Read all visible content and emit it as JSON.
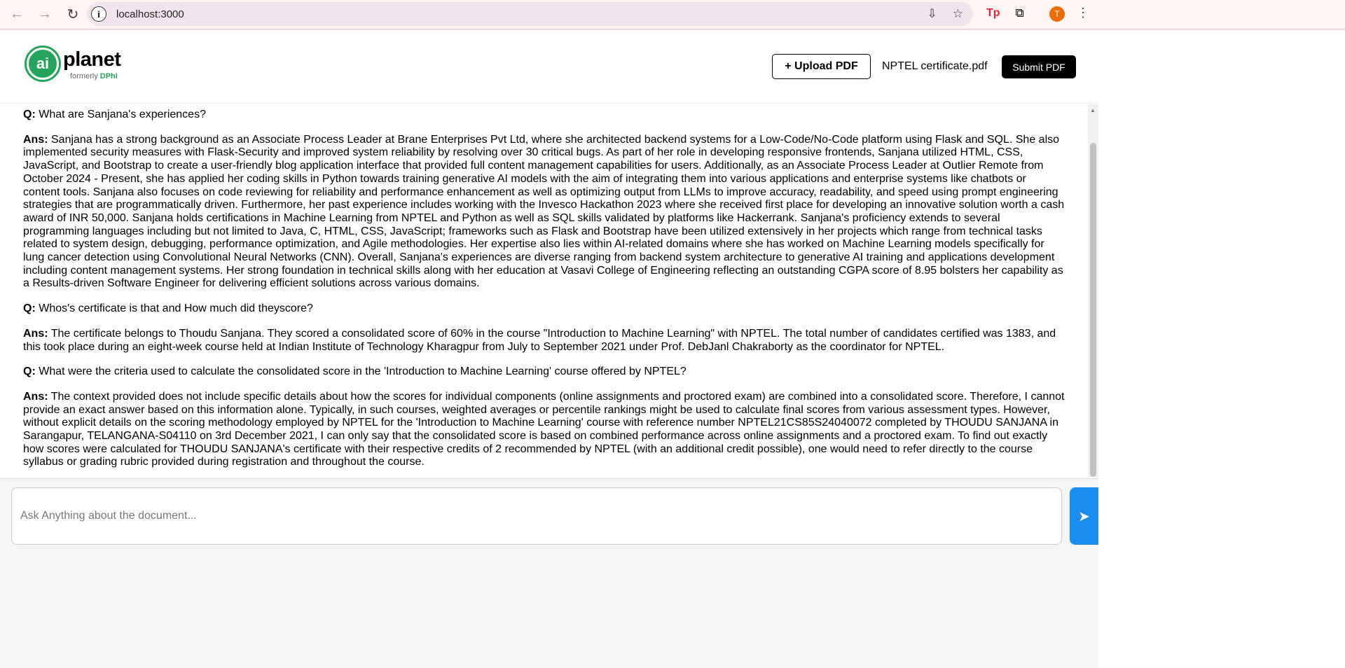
{
  "browser": {
    "url": "localhost:3000",
    "avatar_letter": "T",
    "ext_label": "Tp"
  },
  "header": {
    "logo_word": "planet",
    "logo_mark": "ai",
    "logo_sub": "formerly ",
    "logo_sub_brand": "DPhi",
    "upload_label": "+ Upload PDF",
    "file_name": "NPTEL certificate.pdf",
    "submit_label": "Submit PDF"
  },
  "messages": [
    {
      "q_label": "Q:",
      "q": " What are Sanjana's experiences?",
      "a_label": "Ans:",
      "a": " Sanjana has a strong background as an Associate Process Leader at Brane Enterprises Pvt Ltd, where she architected backend systems for a Low-Code/No-Code platform using Flask and SQL. She also implemented security measures with Flask-Security and improved system reliability by resolving over 30 critical bugs. As part of her role in developing responsive frontends, Sanjana utilized HTML, CSS, JavaScript, and Bootstrap to create a user-friendly blog application interface that provided full content management capabilities for users. Additionally, as an Associate Process Leader at Outlier Remote from October 2024 - Present, she has applied her coding skills in Python towards training generative AI models with the aim of integrating them into various applications and enterprise systems like chatbots or content tools. Sanjana also focuses on code reviewing for reliability and performance enhancement as well as optimizing output from LLMs to improve accuracy, readability, and speed using prompt engineering strategies that are programmatically driven. Furthermore, her past experience includes working with the Invesco Hackathon 2023 where she received first place for developing an innovative solution worth a cash award of INR 50,000. Sanjana holds certifications in Machine Learning from NPTEL and Python as well as SQL skills validated by platforms like Hackerrank. Sanjana's proficiency extends to several programming languages including but not limited to Java, C, HTML, CSS, JavaScript; frameworks such as Flask and Bootstrap have been utilized extensively in her projects which range from technical tasks related to system design, debugging, performance optimization, and Agile methodologies. Her expertise also lies within AI-related domains where she has worked on Machine Learning models specifically for lung cancer detection using Convolutional Neural Networks (CNN). Overall, Sanjana's experiences are diverse ranging from backend system architecture to generative AI training and applications development including content management systems. Her strong foundation in technical skills along with her education at Vasavi College of Engineering reflecting an outstanding CGPA score of 8.95 bolsters her capability as a Results-driven Software Engineer for delivering efficient solutions across various domains."
    },
    {
      "q_label": "Q:",
      "q": " Whos's certificate is that and How much did theyscore?",
      "a_label": "Ans:",
      "a": " The certificate belongs to Thoudu Sanjana. They scored a consolidated score of 60% in the course \"Introduction to Machine Learning\" with NPTEL. The total number of candidates certified was 1383, and this took place during an eight-week course held at Indian Institute of Technology Kharagpur from July to September 2021 under Prof. DebJanl Chakraborty as the coordinator for NPTEL."
    },
    {
      "q_label": "Q:",
      "q": " What were the criteria used to calculate the consolidated score in the 'Introduction to Machine Learning' course offered by NPTEL?",
      "a_label": "Ans:",
      "a": " The context provided does not include specific details about how the scores for individual components (online assignments and proctored exam) are combined into a consolidated score. Therefore, I cannot provide an exact answer based on this information alone. Typically, in such courses, weighted averages or percentile rankings might be used to calculate final scores from various assessment types. However, without explicit details on the scoring methodology employed by NPTEL for the 'Introduction to Machine Learning' course with reference number NPTEL21CS85S24040072 completed by THOUDU SANJANA in Sarangapur, TELANGANA-S04110 on 3rd December 2021, I can only say that the consolidated score is based on combined performance across online assignments and a proctored exam. To find out exactly how scores were calculated for THOUDU SANJANA's certificate with their respective credits of 2 recommended by NPTEL (with an additional credit possible), one would need to refer directly to the course syllabus or grading rubric provided during registration and throughout the course."
    }
  ],
  "input": {
    "placeholder": "Ask Anything about the document...",
    "send_icon": "➤"
  }
}
